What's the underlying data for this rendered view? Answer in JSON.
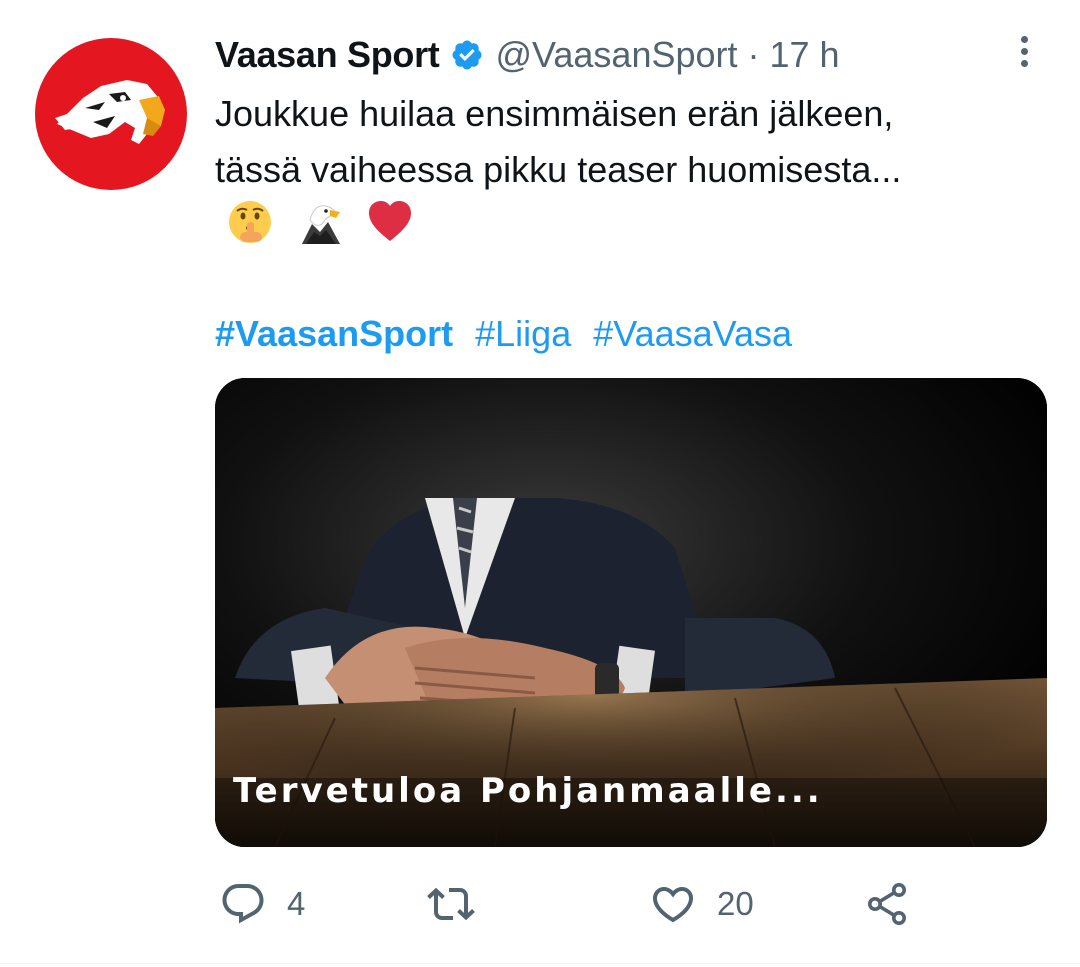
{
  "author": {
    "name": "Vaasan Sport",
    "verified": true,
    "handle": "@VaasanSport",
    "separator": "·",
    "time": "17 h",
    "avatar_icon": "eagle-logo-icon"
  },
  "tweet": {
    "lines": [
      "Joukkue huilaa ensimmäisen erän jälkeen,",
      "tässä vaiheessa pikku teaser huomisesta..."
    ],
    "emojis": [
      "shushing-face-icon",
      "eagle-icon",
      "red-heart-icon"
    ],
    "hashtags": [
      "#VaasanSport",
      "#Liiga",
      "#VaasaVasa"
    ]
  },
  "media": {
    "caption": "Tervetuloa Pohjanmaalle..."
  },
  "actions": {
    "reply": {
      "icon": "reply-icon",
      "count": "4"
    },
    "retweet": {
      "icon": "retweet-icon",
      "count": ""
    },
    "like": {
      "icon": "heart-icon",
      "count": "20"
    },
    "share": {
      "icon": "share-icon"
    }
  },
  "colors": {
    "accent": "#1d9bf0",
    "text": "#0f1419",
    "secondary": "#536471",
    "avatar_bg": "#e4161f"
  }
}
